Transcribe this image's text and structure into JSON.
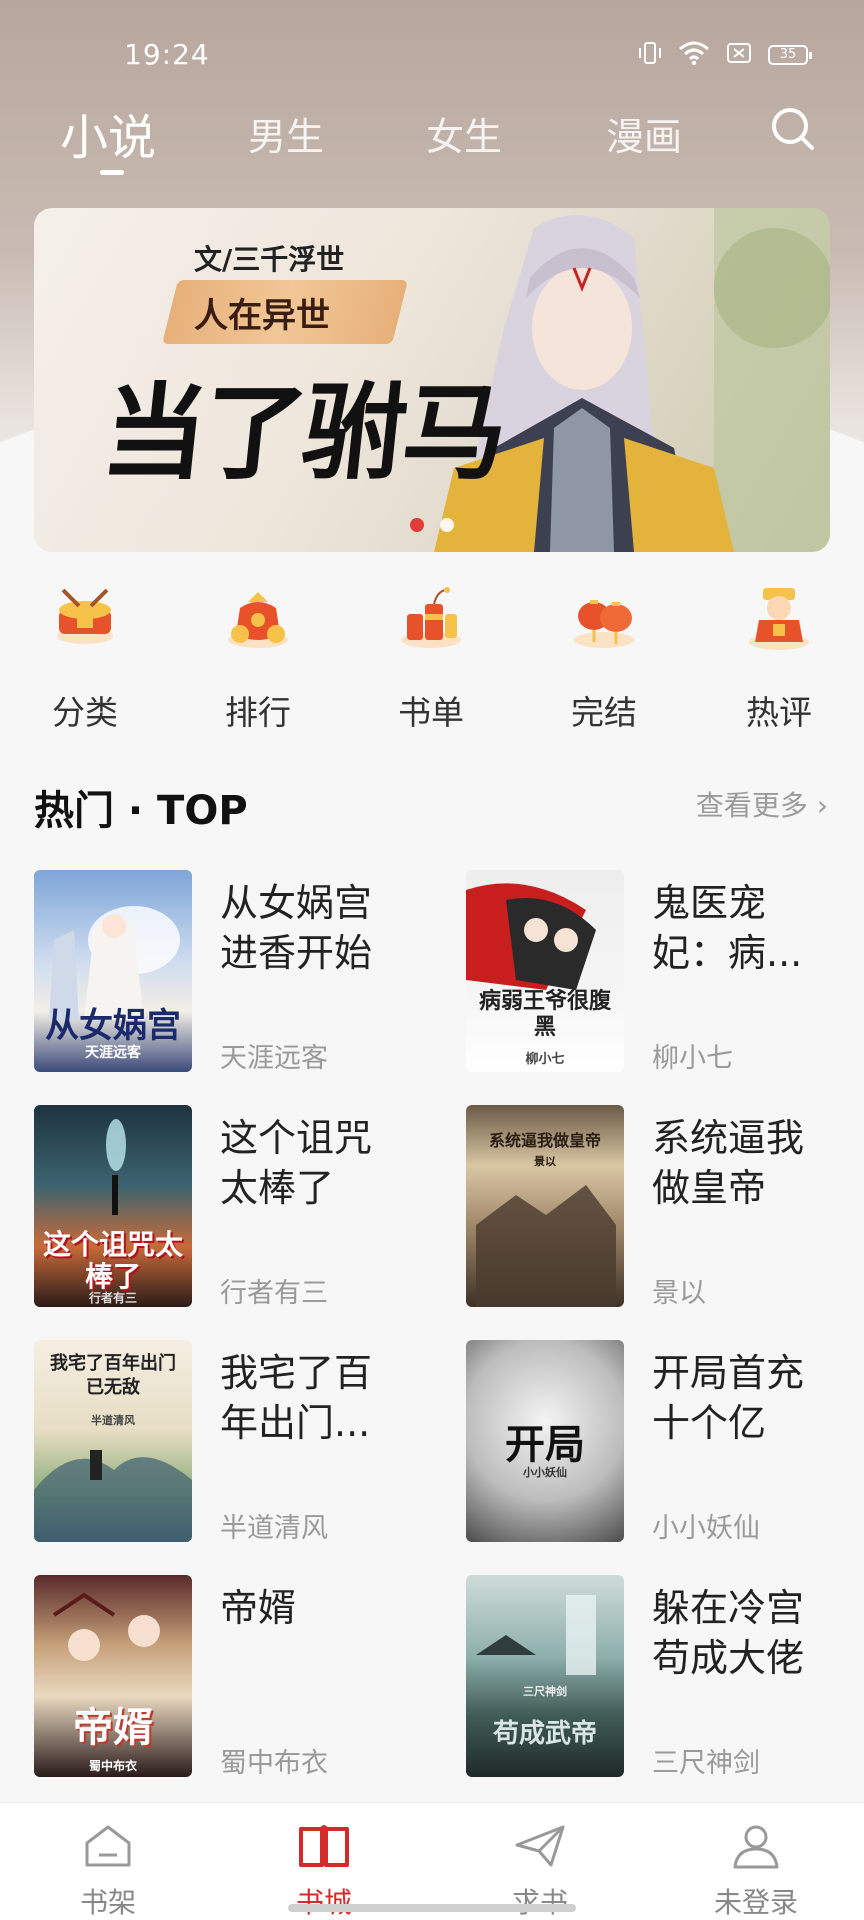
{
  "status_bar": {
    "time": "19:24",
    "battery": "35",
    "icons": [
      "vibrate-icon",
      "wifi-icon",
      "sim-icon",
      "battery-icon"
    ]
  },
  "top_tabs": {
    "items": [
      "小说",
      "男生",
      "女生",
      "漫画"
    ],
    "active_index": 0
  },
  "banner": {
    "author_line": "文/三千浮世",
    "subtitle": "人在异世",
    "title": "当了驸马",
    "page_count": 2,
    "active_page": 0
  },
  "categories": [
    {
      "label": "分类",
      "icon": "drum-icon"
    },
    {
      "label": "排行",
      "icon": "money-bag-icon"
    },
    {
      "label": "书单",
      "icon": "firecracker-icon"
    },
    {
      "label": "完结",
      "icon": "lantern-icon"
    },
    {
      "label": "热评",
      "icon": "fortune-god-icon"
    }
  ],
  "hot_section": {
    "title": "热门 · TOP",
    "see_more": "查看更多"
  },
  "books": [
    {
      "title": "从女娲宫进香开始",
      "title_display": "从女娲宫\n进香开始",
      "author": "天涯远客",
      "cover_text": "从女娲宫",
      "cover_sub": "天涯远客"
    },
    {
      "title": "鬼医宠妃：病...",
      "title_display": "鬼医宠\n妃：病...",
      "author": "柳小七",
      "cover_text": "病弱王爷很腹黑",
      "cover_sub": "柳小七"
    },
    {
      "title": "这个诅咒太棒了",
      "title_display": "这个诅咒\n太棒了",
      "author": "行者有三",
      "cover_text": "这个诅咒太棒了",
      "cover_sub": "行者有三"
    },
    {
      "title": "系统逼我做皇帝",
      "title_display": "系统逼我\n做皇帝",
      "author": "景以",
      "cover_text": "系统逼我做皇帝",
      "cover_sub": "景以"
    },
    {
      "title": "我宅了百年出门...",
      "title_display": "我宅了百\n年出门...",
      "author": "半道清风",
      "cover_text": "我宅了百年出门已无敌",
      "cover_sub": "半道清风"
    },
    {
      "title": "开局首充十个亿",
      "title_display": "开局首充\n十个亿",
      "author": "小小妖仙",
      "cover_text": "开局",
      "cover_sub": "小小妖仙"
    },
    {
      "title": "帝婿",
      "title_display": "帝婿",
      "author": "蜀中布衣",
      "cover_text": "帝婿",
      "cover_sub": "蜀中布衣"
    },
    {
      "title": "躲在冷宫苟成大佬",
      "title_display": "躲在冷宫\n苟成大佬",
      "author": "三尺神剑",
      "cover_text": "苟成武帝",
      "cover_sub": "三尺神剑"
    }
  ],
  "bottom_nav": {
    "items": [
      {
        "label": "书架",
        "icon": "bookshelf-icon"
      },
      {
        "label": "书城",
        "icon": "book-open-icon"
      },
      {
        "label": "求书",
        "icon": "paper-plane-icon"
      },
      {
        "label": "未登录",
        "icon": "user-icon"
      }
    ],
    "active_index": 1
  },
  "colors": {
    "accent": "#d42a2a",
    "muted_text": "#9a9a9a",
    "header_bg": "#b7a69d"
  }
}
